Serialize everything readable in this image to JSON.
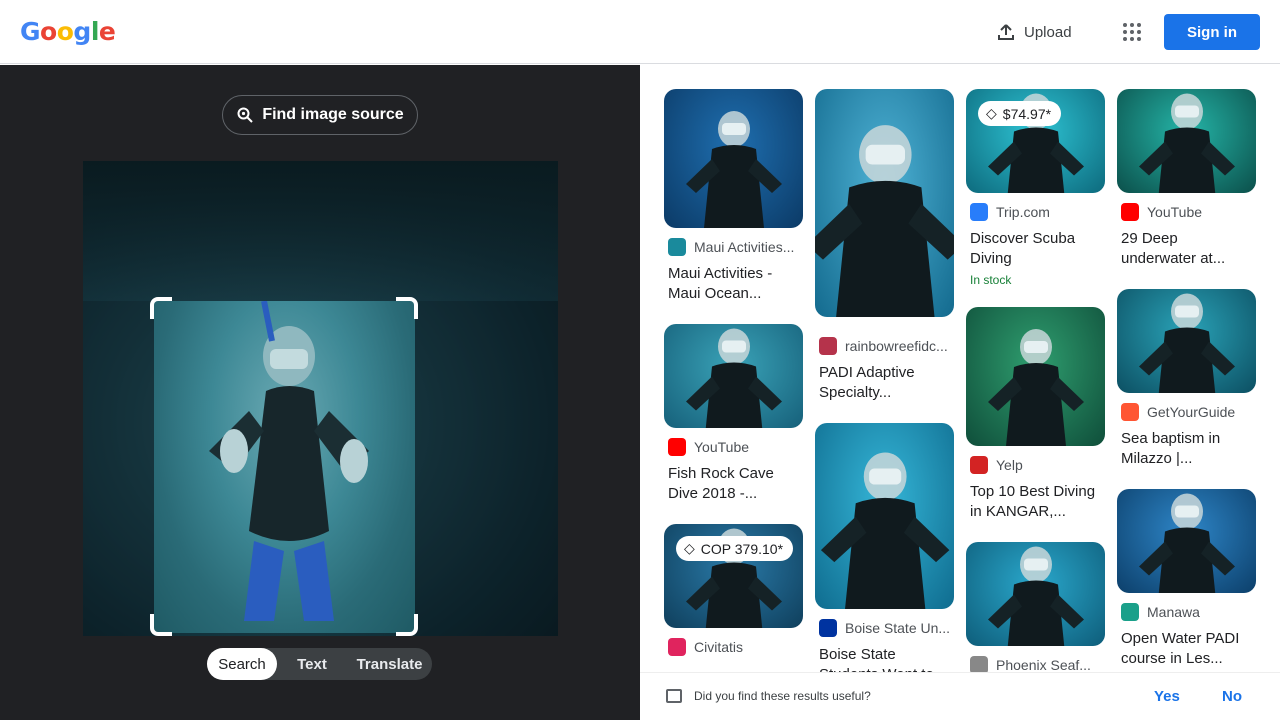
{
  "header": {
    "logo_letters": [
      {
        "char": "G",
        "color": "#4285F4"
      },
      {
        "char": "o",
        "color": "#EA4335"
      },
      {
        "char": "o",
        "color": "#FBBC05"
      },
      {
        "char": "g",
        "color": "#4285F4"
      },
      {
        "char": "l",
        "color": "#34A853"
      },
      {
        "char": "e",
        "color": "#EA4335"
      }
    ],
    "upload_label": "Upload",
    "signin_label": "Sign in"
  },
  "lens": {
    "find_source_label": "Find image source",
    "modes": [
      {
        "label": "Search",
        "active": true
      },
      {
        "label": "Text",
        "active": false
      },
      {
        "label": "Translate",
        "active": false
      }
    ]
  },
  "results": {
    "columns": [
      [
        {
          "source": "Maui Activities...",
          "title": "Maui Activities - Maui Ocean...",
          "icon": "sea-turtle-icon",
          "icon_color": "#1a8a9c",
          "thumb_h": 139,
          "tone": [
            "#1f6fb0",
            "#0b3a66"
          ]
        },
        {
          "source": "YouTube",
          "title": "Fish Rock Cave Dive 2018 -...",
          "icon": "youtube-icon",
          "icon_color": "#ff0000",
          "thumb_h": 104,
          "tone": [
            "#3aa3b8",
            "#16607a"
          ]
        },
        {
          "source": "Civitatis",
          "title": "",
          "price": "COP 379.10*",
          "icon": "civitatis-icon",
          "icon_color": "#e0245e",
          "thumb_h": 104,
          "tone": [
            "#2a7aa8",
            "#0f3f5c"
          ]
        }
      ],
      [
        {
          "source": "",
          "title": "",
          "icon": "",
          "icon_color": "",
          "thumb_h": 228,
          "tone": [
            "#4fb3d6",
            "#136a8e"
          ]
        },
        {
          "source": "rainbowreefidc...",
          "title": "PADI Adaptive Specialty...",
          "icon": "rainbow-reef-icon",
          "icon_color": "#b5334b",
          "thumb_h": 0,
          "tone": [
            "#ffffff",
            "#ffffff"
          ]
        },
        {
          "source": "Boise State Un...",
          "title": "Boise State Students Went to...",
          "icon": "boise-state-icon",
          "icon_color": "#0033a0",
          "thumb_h": 186,
          "tone": [
            "#35b6d8",
            "#0f6c8f"
          ]
        }
      ],
      [
        {
          "source": "Trip.com",
          "title": "Discover Scuba Diving",
          "stock": "In stock",
          "price": "$74.97*",
          "icon": "trip-icon",
          "icon_color": "#287dfa",
          "thumb_h": 104,
          "tone": [
            "#2ec4d4",
            "#0d6a7d"
          ]
        },
        {
          "source": "Yelp",
          "title": "Top 10 Best Diving in KANGAR,...",
          "icon": "yelp-icon",
          "icon_color": "#d32323",
          "thumb_h": 139,
          "tone": [
            "#2f9e6f",
            "#0f4e3a"
          ]
        },
        {
          "source": "Phoenix Seaf...",
          "title": "",
          "icon": "phoenix-icon",
          "icon_color": "#888888",
          "thumb_h": 104,
          "tone": [
            "#2aa8cc",
            "#0e5d7a"
          ]
        }
      ],
      [
        {
          "source": "YouTube",
          "title": "29 Deep underwater at...",
          "icon": "youtube-icon",
          "icon_color": "#ff0000",
          "thumb_h": 104,
          "tone": [
            "#25b5a8",
            "#0b4f4a"
          ]
        },
        {
          "source": "GetYourGuide",
          "title": "Sea baptism in Milazzo |...",
          "icon": "getyourguide-icon",
          "icon_color": "#ff5533",
          "thumb_h": 104,
          "tone": [
            "#2aa3b8",
            "#0c4f62"
          ]
        },
        {
          "source": "Manawa",
          "title": "Open Water PADI course in Les...",
          "icon": "manawa-icon",
          "icon_color": "#1aa08a",
          "thumb_h": 104,
          "tone": [
            "#2e86c8",
            "#0c3f6a"
          ]
        }
      ]
    ]
  },
  "feedback": {
    "question": "Did you find these results useful?",
    "yes": "Yes",
    "no": "No"
  }
}
